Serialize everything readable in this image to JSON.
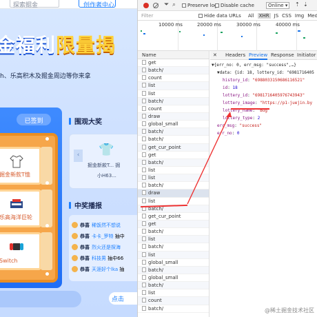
{
  "game": {
    "search_placeholder": "探索掘金",
    "creator_center": "创作者中心",
    "headline_white": "金福利",
    "headline_yellow": "限量",
    "headline_tail": "揭",
    "subline": "h、乐高积木及掘金周边等你来拿",
    "signed_button": "已签到",
    "prizes": [
      {
        "label": "掘金新款T恤",
        "icon": "tshirt-icon"
      },
      {
        "label": "乐高海洋巨轮",
        "icon": "lego-ship-icon"
      },
      {
        "label": "Switch",
        "icon": "switch-icon"
      }
    ],
    "onlook_title": "围观大奖",
    "onlook_prize_text": "掘金新款T... 掘",
    "onlook_user": "小H63...",
    "winners_title": "中奖播报",
    "winners": [
      {
        "prefix": "恭喜",
        "user": "稀饭然不想说",
        "tail": ""
      },
      {
        "prefix": "恭喜",
        "user": "卡卡_罗特",
        "tail": "抽中"
      },
      {
        "prefix": "恭喜",
        "user": "烈火还是探海",
        "tail": ""
      },
      {
        "prefix": "恭喜",
        "user": "科技男",
        "tail": "抽中66"
      },
      {
        "prefix": "恭喜",
        "user": "天涯好个lka",
        "tail": "抽"
      }
    ],
    "bottom_button": "点击"
  },
  "devtools": {
    "toolbar": {
      "preserve_log": "Preserve log",
      "disable_cache": "Disable cache",
      "throttle": "Online"
    },
    "filterbar": {
      "filter_placeholder": "Filter",
      "hide_data_urls": "Hide data URLs",
      "types": [
        "All",
        "XHR",
        "JS",
        "CSS",
        "Img",
        "Media",
        "Fo"
      ]
    },
    "timeline_ticks": [
      "10000 ms",
      "20000 ms",
      "30000 ms",
      "40000 ms"
    ],
    "name_header": "Name",
    "requests": [
      "get",
      "batch/",
      "count",
      "list",
      "list",
      "batch/",
      "count",
      "draw",
      "global_small",
      "batch/",
      "batch/",
      "get_cur_point",
      "get",
      "batch/",
      "list",
      "list",
      "batch/",
      "draw",
      "list",
      "batch/",
      "get_cur_point",
      "get",
      "batch/",
      "list",
      "batch/",
      "list",
      "global_small",
      "batch/",
      "global_small",
      "batch/",
      "list",
      "count",
      "batch/"
    ],
    "selected_request_index": 17,
    "detail_tabs": [
      "Headers",
      "Preview",
      "Response",
      "Initiator"
    ],
    "active_tab": "Preview",
    "json_lines": [
      {
        "indent": 0,
        "text": "▼{err_no: 0, err_msg: \"success\",…}"
      },
      {
        "indent": 1,
        "text": "▼data: {id: 18, lottery_id: \"6981716405"
      },
      {
        "indent": 2,
        "key": "history_id",
        "value": "\"6988033150686116521\""
      },
      {
        "indent": 2,
        "key": "id",
        "value": "18"
      },
      {
        "indent": 2,
        "key": "lottery_id",
        "value": "\"6981716405976743943\""
      },
      {
        "indent": 2,
        "key": "lottery_image",
        "value": "\"https://p1-juejin.by"
      },
      {
        "indent": 2,
        "key": "lottery_name",
        "value": "\"Bug\""
      },
      {
        "indent": 2,
        "key": "lottery_type",
        "value": "2"
      },
      {
        "indent": 1,
        "key": "err_msg",
        "value": "\"success\""
      },
      {
        "indent": 1,
        "key": "err_no",
        "value": "0"
      }
    ],
    "watermark": "@稀土掘金技术社区"
  }
}
